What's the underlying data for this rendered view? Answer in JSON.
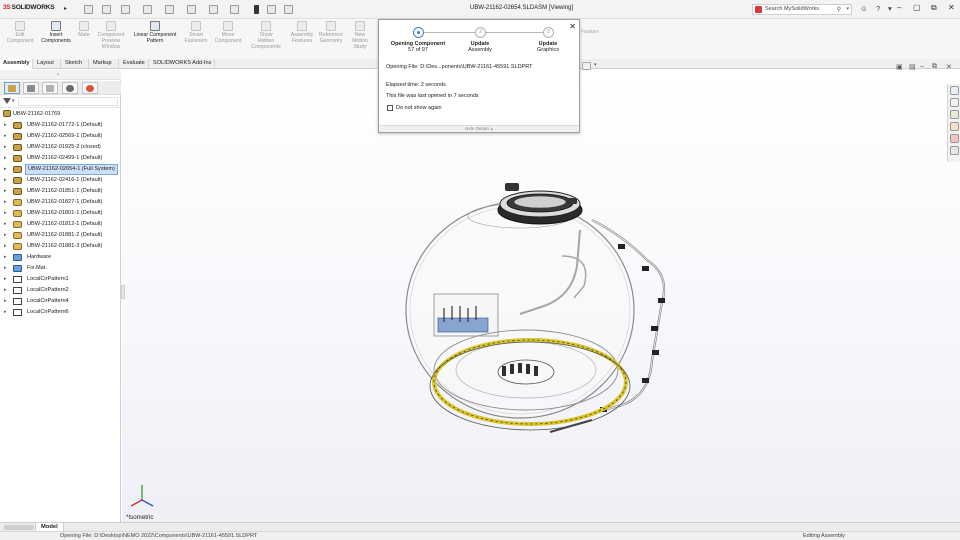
{
  "app": {
    "name": "SOLIDWORKS",
    "logo_prefix": "3S"
  },
  "window": {
    "title": "UBW-21162-02654.SLDASM [Viewing]",
    "search_placeholder": "Search MySolidWorks",
    "controls": [
      "minimize",
      "restore",
      "close"
    ]
  },
  "command_manager": {
    "buttons": [
      {
        "label": "Edit\nComponent",
        "active": false
      },
      {
        "label": "Insert\nComponents",
        "active": true
      },
      {
        "label": "Mate",
        "active": false
      },
      {
        "label": "Component\nPreview\nWindow",
        "active": false
      },
      {
        "label": "Linear Component\nPattern",
        "active": true
      },
      {
        "label": "Smart\nFasteners",
        "active": false
      },
      {
        "label": "Move\nComponent",
        "active": false
      },
      {
        "label": "Show\nHidden\nComponents",
        "active": false
      },
      {
        "label": "Assembly\nFeatures",
        "active": false
      },
      {
        "label": "Reference\nGeometry",
        "active": false
      },
      {
        "label": "New\nMotion\nStudy",
        "active": false
      }
    ],
    "partially_hidden_label": "Feature"
  },
  "tabs": [
    {
      "label": "Assembly",
      "active": true
    },
    {
      "label": "Layout",
      "active": false
    },
    {
      "label": "Sketch",
      "active": false
    },
    {
      "label": "Markup",
      "active": false
    },
    {
      "label": "Evaluate",
      "active": false
    },
    {
      "label": "SOLIDWORKS Add-Ins",
      "active": false
    }
  ],
  "feature_tree": {
    "root": "UBW-21162-01769",
    "items": [
      {
        "label": "UBW-21162-01772-1 (Default)",
        "icon": "assembly-icon",
        "expandable": true,
        "selected": false
      },
      {
        "label": "UBW-21162-02569-1 (Default)",
        "icon": "assembly-icon",
        "expandable": true,
        "selected": false
      },
      {
        "label": "UBW-21162-01925-2 (closed)",
        "icon": "assembly-icon",
        "expandable": true,
        "selected": false
      },
      {
        "label": "UBW-21162-02499-1 (Default)",
        "icon": "assembly-icon",
        "expandable": true,
        "selected": false
      },
      {
        "label": "UBW-21162-02654-1 (Full System)",
        "icon": "assembly-icon",
        "expandable": true,
        "selected": true
      },
      {
        "label": "UBW-21162-02416-1 (Default)",
        "icon": "assembly-icon",
        "expandable": true,
        "selected": false
      },
      {
        "label": "UBW-21162-01851-1 (Default)",
        "icon": "assembly-icon",
        "expandable": true,
        "selected": false
      },
      {
        "label": "UBW-21162-01827-1 (Default)",
        "icon": "part-icon",
        "expandable": false,
        "selected": false
      },
      {
        "label": "UBW-21162-01801-1 (Default)",
        "icon": "part-icon",
        "expandable": false,
        "selected": false
      },
      {
        "label": "UBW-21162-01812-1 (Default)",
        "icon": "part-icon",
        "expandable": false,
        "selected": false
      },
      {
        "label": "UBW-21162-01881-2 (Default)",
        "icon": "part-icon",
        "expandable": false,
        "selected": false
      },
      {
        "label": "UBW-21162-01881-3 (Default)",
        "icon": "part-icon",
        "expandable": false,
        "selected": false
      },
      {
        "label": "Hardware",
        "icon": "folder-icon",
        "expandable": true,
        "selected": false
      },
      {
        "label": "Fix.Mat.",
        "icon": "folder-icon",
        "expandable": true,
        "selected": false
      },
      {
        "label": "LocalCirPattern1",
        "icon": "pattern-icon",
        "expandable": true,
        "selected": false
      },
      {
        "label": "LocalCirPattern2",
        "icon": "pattern-icon",
        "expandable": true,
        "selected": false
      },
      {
        "label": "LocalCirPattern4",
        "icon": "pattern-icon",
        "expandable": true,
        "selected": false
      },
      {
        "label": "LocalCirPattern6",
        "icon": "pattern-icon",
        "expandable": true,
        "selected": false
      }
    ]
  },
  "popup": {
    "steps": [
      {
        "title": "Opening Component",
        "sub": "57 of 97",
        "num": "1",
        "active": true
      },
      {
        "title": "Update",
        "sub": "Assembly",
        "num": "2",
        "active": false
      },
      {
        "title": "Update",
        "sub": "Graphics",
        "num": "3",
        "active": false
      }
    ],
    "opening_file": "Opening File: D:\\Des...ponents\\UBW-21161-45591.SLDPRT",
    "elapsed": "Elapsed time: 2 seconds",
    "last_opened": "This file was last opened in 7 seconds",
    "checkbox_label": "Do not show again",
    "hide_label": "Hide Details"
  },
  "viewport": {
    "view_label": "*Isometric"
  },
  "model_tabs": {
    "active": "Model"
  },
  "status_bar": {
    "left": "Opening File: D:\\Desktop\\NEMO 2022\\Components\\UBW-21161-45591.SLDPRT",
    "right": "Editing Assembly"
  },
  "colors": {
    "accent": "#3f7fcf",
    "selection": "#cce0f7",
    "brand_red": "#d32020",
    "ring_yellow": "#d9c52a"
  }
}
